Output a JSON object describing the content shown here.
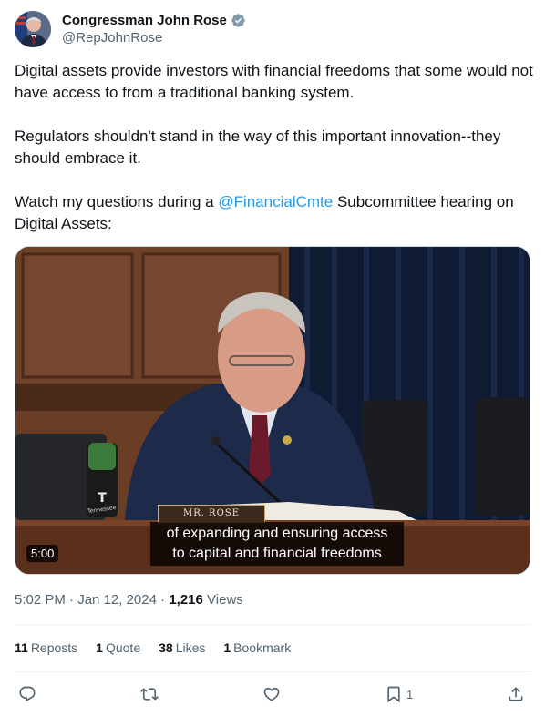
{
  "author": {
    "name": "Congressman John Rose",
    "handle": "@RepJohnRose"
  },
  "tweet": {
    "paragraph1": "Digital assets provide investors with financial freedoms that some would not have access to from a traditional banking system.",
    "paragraph2": "Regulators shouldn't stand in the way of this important innovation--they should embrace it.",
    "paragraph3_prefix": "Watch my questions during a ",
    "mention": "@FinancialCmte",
    "paragraph3_suffix": " Subcommittee hearing on Digital Assets:"
  },
  "video": {
    "duration": "5:00",
    "nameplate": "MR. ROSE",
    "caption_line1": "of expanding and ensuring access",
    "caption_line2": "to capital and financial freedoms",
    "bottle_label": "Tennessee"
  },
  "meta": {
    "time": "5:02 PM",
    "sep1": "·",
    "date": "Jan 12, 2024",
    "sep2": "·",
    "views_count": "1,216",
    "views_label": "Views"
  },
  "stats": {
    "reposts_count": "11",
    "reposts_label": "Reposts",
    "quotes_count": "1",
    "quotes_label": "Quote",
    "likes_count": "38",
    "likes_label": "Likes",
    "bookmarks_count": "1",
    "bookmarks_label": "Bookmark"
  },
  "actions": {
    "bookmark_count": "1"
  },
  "colors": {
    "link": "#1d9bf0",
    "secondary_text": "#536471",
    "primary_text": "#0f1419",
    "verified_badge": "#829aab"
  }
}
